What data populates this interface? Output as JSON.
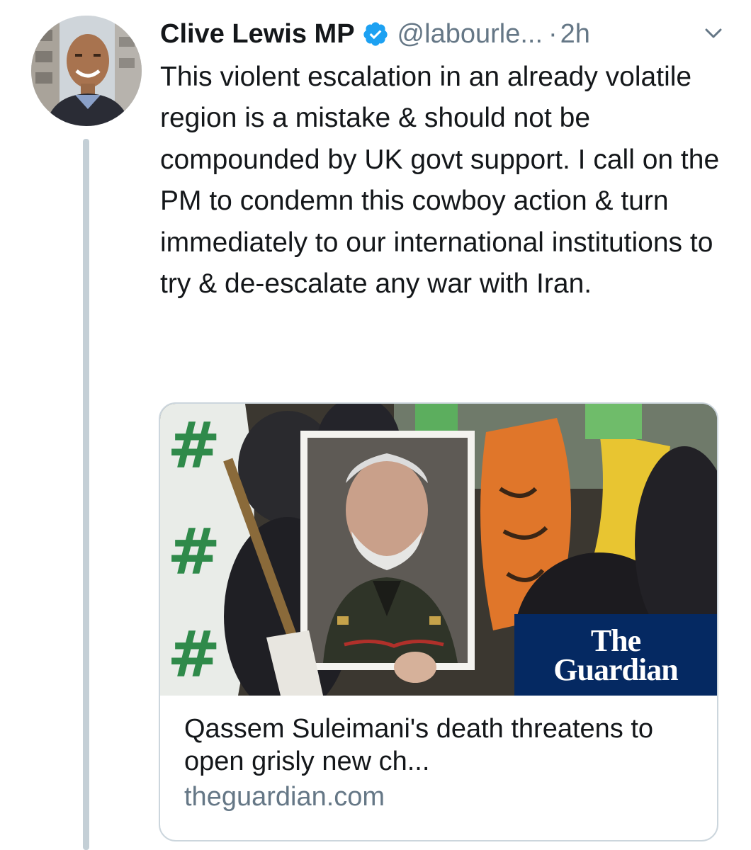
{
  "tweet": {
    "author": {
      "display_name": "Clive Lewis MP",
      "handle": "@labourle...",
      "verified_icon": "verified-badge-icon",
      "avatar_icon": "avatar"
    },
    "separator": "·",
    "timestamp": "2h",
    "menu_icon": "chevron-down-icon",
    "text": "This violent escalation in an already volatile region is a mistake & should not be compounded by UK govt support. I call on the PM to condemn this cowboy action & turn immediately to our international institutions to try & de-escalate any war with Iran.",
    "card": {
      "logo_line1": "The",
      "logo_line2": "Guardian",
      "title": "Qassem Suleimani's death threatens to open grisly new ch...",
      "domain": "theguardian.com"
    }
  },
  "colors": {
    "primary_text": "#14171a",
    "secondary_text": "#657786",
    "verified_blue": "#1da1f2",
    "border": "#ccd6dd",
    "thread_line": "#c4cfd6",
    "guardian_navy": "#052962"
  }
}
